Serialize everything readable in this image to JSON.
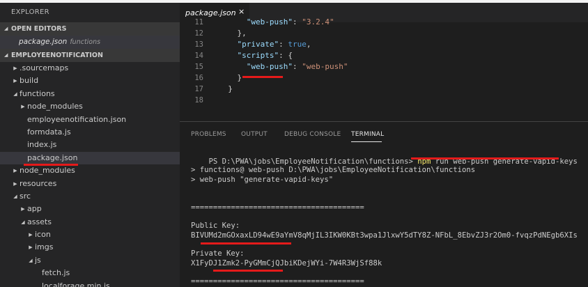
{
  "sidebar": {
    "title": "EXPLORER",
    "open_editors": {
      "label": "OPEN EDITORS",
      "item_name": "package.json",
      "item_desc": "functions"
    },
    "project": {
      "label": "EMPLOYEENOTIFICATION",
      "items": [
        {
          "label": ".sourcemaps",
          "depth": 0,
          "type": "folder-collapsed"
        },
        {
          "label": "build",
          "depth": 0,
          "type": "folder-collapsed"
        },
        {
          "label": "functions",
          "depth": 0,
          "type": "folder-expanded"
        },
        {
          "label": "node_modules",
          "depth": 1,
          "type": "folder-collapsed"
        },
        {
          "label": "employeenotification.json",
          "depth": 1,
          "type": "file"
        },
        {
          "label": "formdata.js",
          "depth": 1,
          "type": "file"
        },
        {
          "label": "index.js",
          "depth": 1,
          "type": "file"
        },
        {
          "label": "package.json",
          "depth": 1,
          "type": "file",
          "selected": true
        },
        {
          "label": "node_modules",
          "depth": 0,
          "type": "folder-collapsed"
        },
        {
          "label": "resources",
          "depth": 0,
          "type": "folder-collapsed"
        },
        {
          "label": "src",
          "depth": 0,
          "type": "folder-expanded"
        },
        {
          "label": "app",
          "depth": 1,
          "type": "folder-collapsed"
        },
        {
          "label": "assets",
          "depth": 1,
          "type": "folder-expanded"
        },
        {
          "label": "icon",
          "depth": 2,
          "type": "folder-collapsed"
        },
        {
          "label": "imgs",
          "depth": 2,
          "type": "folder-collapsed"
        },
        {
          "label": "js",
          "depth": 2,
          "type": "folder-expanded"
        },
        {
          "label": "fetch.js",
          "depth": 3,
          "type": "file"
        },
        {
          "label": "localforage.min.js",
          "depth": 3,
          "type": "file"
        }
      ]
    }
  },
  "editor": {
    "tab_label": "package.json",
    "close_glyph": "×",
    "lines": [
      {
        "n": "11",
        "indent": "      ",
        "key": "\"web-push\"",
        "colon": ": ",
        "val": "\"3.2.4\"",
        "valtype": "s",
        "tail": ""
      },
      {
        "n": "12",
        "indent": "    ",
        "key": "",
        "colon": "",
        "val": "",
        "valtype": "",
        "tail": "},"
      },
      {
        "n": "13",
        "indent": "    ",
        "key": "\"private\"",
        "colon": ": ",
        "val": "true",
        "valtype": "b",
        "tail": ","
      },
      {
        "n": "14",
        "indent": "    ",
        "key": "\"scripts\"",
        "colon": ": ",
        "val": "",
        "valtype": "",
        "tail": "{"
      },
      {
        "n": "15",
        "indent": "      ",
        "key": "\"web-push\"",
        "colon": ": ",
        "val": "\"web-push\"",
        "valtype": "s",
        "tail": ""
      },
      {
        "n": "16",
        "indent": "    ",
        "key": "",
        "colon": "",
        "val": "",
        "valtype": "",
        "tail": "}"
      },
      {
        "n": "17",
        "indent": "  ",
        "key": "",
        "colon": "",
        "val": "",
        "valtype": "",
        "tail": "}"
      },
      {
        "n": "18",
        "indent": "",
        "key": "",
        "colon": "",
        "val": "",
        "valtype": "",
        "tail": ""
      }
    ]
  },
  "panel": {
    "tabs": [
      "PROBLEMS",
      "OUTPUT",
      "DEBUG CONSOLE",
      "TERMINAL"
    ],
    "active_tab": "TERMINAL",
    "terminal": {
      "prompt": "PS D:\\PWA\\jobs\\EmployeeNotification\\functions> ",
      "command_npm": "npm",
      "command_rest": " run web-push generate-vapid-keys",
      "out1": "> functions@ web-push D:\\PWA\\jobs\\EmployeeNotification\\functions",
      "out2": "> web-push \"generate-vapid-keys\"",
      "sep": "=======================================",
      "pub_label": "Public Key:",
      "pub_value": "BIVUMd2mGOxaxLD94wE9aYmV8qMjIL3IKW0KBt3wpa1JlxwY5dTY8Z-NFbL_8EbvZJ3r2Om0-fvqzPdNEgb6XIs",
      "priv_label": "Private Key:",
      "priv_value": "X1FyDJ1Zmk2-PyGMmCjQJbiKDejWYi-7W4R3WjSf88k",
      "sep2": "======================================="
    }
  },
  "colors": {
    "annotation_red": "#e51a1a",
    "npm_yellow": "#f5e56b",
    "string": "#ce9178",
    "key": "#9cdcfe",
    "boolean": "#569cd6"
  }
}
